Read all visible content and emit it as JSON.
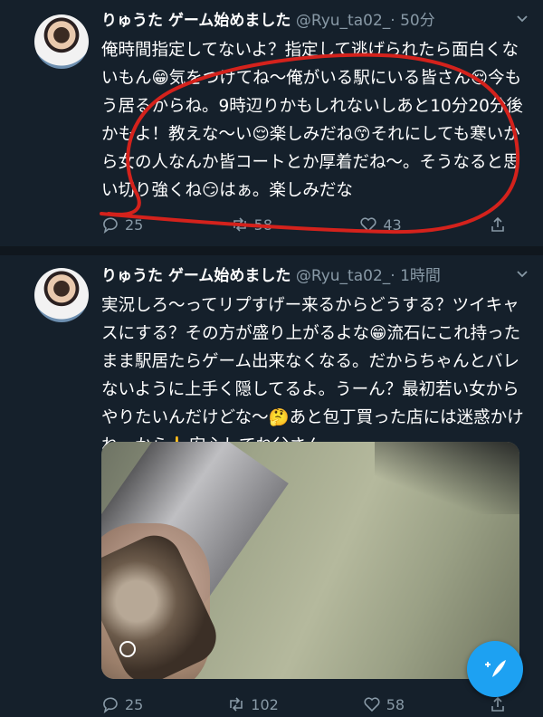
{
  "tweets": [
    {
      "display_name": "りゅうた ゲーム始めました",
      "handle": "@Ryu_ta02_",
      "time": "· 50分",
      "text": "俺時間指定してないよ？指定して逃げられたら面白くないもん😁気をつけてね〜俺がいる駅にいる皆さん😌今もう居るからね。9時辺りかもしれないしあと10分20分後かもよ！教えな〜い😌楽しみだね😙それにしても寒いから女の人なんか皆コートとか厚着だね〜。そうなると思い切り強くね😏はぁ。楽しみだな",
      "actions": {
        "reply": "25",
        "retweet": "58",
        "like": "43"
      },
      "avatar_icon": "profile-photo"
    },
    {
      "display_name": "りゅうた ゲーム始めました",
      "handle": "@Ryu_ta02_",
      "time": "· 1時間",
      "text": "実況しろ〜ってリプすげー来るからどうする？ツイキャスにする？その方が盛り上がるよな😁流石にこれ持ったまま駅居たらゲーム出来なくなる。だからちゃんとバレないように上手く隠してるよ。うーん？最初若い女からやりたいんだけどな〜🤔あと包丁買った店には迷惑かけねーから👆安心してね父さん。",
      "actions": {
        "reply": "25",
        "retweet": "102",
        "like": "58"
      },
      "avatar_icon": "profile-photo",
      "media": "knife-photo"
    }
  ],
  "colors": {
    "background": "#15202b",
    "secondary_text": "#8899a6",
    "accent": "#1da1f2",
    "annotation": "#d4221c"
  },
  "icons": [
    "chevron-down-icon",
    "reply-icon",
    "retweet-icon",
    "like-icon",
    "share-icon",
    "compose-tweet-icon"
  ]
}
